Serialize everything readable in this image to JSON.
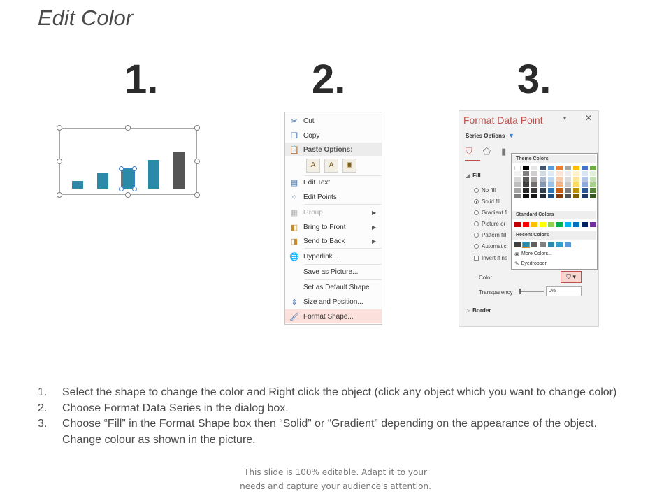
{
  "title": "Edit Color",
  "steps": [
    "1.",
    "2.",
    "3."
  ],
  "chart": {
    "values": [
      1,
      2,
      3,
      4,
      5
    ],
    "selected_index": 2
  },
  "context_menu": {
    "items": [
      {
        "label": "Cut",
        "icon": "scissors-icon",
        "state": "normal"
      },
      {
        "label": "Copy",
        "icon": "copy-icon",
        "state": "normal"
      },
      {
        "label": "Paste Options:",
        "icon": "paste-icon",
        "state": "header"
      },
      {
        "label": "Edit Text",
        "icon": "edit-text-icon",
        "state": "normal"
      },
      {
        "label": "Edit Points",
        "icon": "edit-points-icon",
        "state": "normal"
      },
      {
        "label": "Group",
        "icon": "group-icon",
        "state": "disabled",
        "submenu": true
      },
      {
        "label": "Bring to Front",
        "icon": "bring-to-front-icon",
        "state": "normal",
        "submenu": true
      },
      {
        "label": "Send to Back",
        "icon": "send-to-back-icon",
        "state": "normal",
        "submenu": true
      },
      {
        "label": "Hyperlink...",
        "icon": "hyperlink-icon",
        "state": "normal"
      },
      {
        "label": "Save as Picture...",
        "icon": "",
        "state": "normal"
      },
      {
        "label": "Set as Default Shape",
        "icon": "",
        "state": "normal"
      },
      {
        "label": "Size and Position...",
        "icon": "size-position-icon",
        "state": "normal"
      },
      {
        "label": "Format Shape...",
        "icon": "format-shape-icon",
        "state": "highlight"
      }
    ]
  },
  "format_panel": {
    "title": "Format Data Point",
    "series_options": "Series Options",
    "fill_label": "Fill",
    "fill_options": [
      {
        "label": "No fill",
        "type": "radio",
        "checked": false
      },
      {
        "label": "Solid fill",
        "type": "radio",
        "checked": true
      },
      {
        "label": "Gradient fi",
        "type": "radio",
        "checked": false
      },
      {
        "label": "Picture or",
        "type": "radio",
        "checked": false
      },
      {
        "label": "Pattern fill",
        "type": "radio",
        "checked": false
      },
      {
        "label": "Automatic",
        "type": "radio",
        "checked": false
      },
      {
        "label": "Invert if ne",
        "type": "check",
        "checked": false
      }
    ],
    "color_label": "Color",
    "transparency_label": "Transparency",
    "transparency_value": "0%",
    "border_label": "Border",
    "accent_color": "#c0504d"
  },
  "color_popup": {
    "theme_header": "Theme Colors",
    "theme_colors": [
      [
        "#ffffff",
        "#000000",
        "#e7e6e6",
        "#44546a",
        "#5b9bd5",
        "#ed7d31",
        "#a5a5a5",
        "#ffc000",
        "#4472c4",
        "#70ad47"
      ],
      [
        "#f2f2f2",
        "#7f7f7f",
        "#d0cece",
        "#d6dce4",
        "#deebf6",
        "#fbe5d5",
        "#ededed",
        "#fff2cc",
        "#dae3f3",
        "#e2efd9"
      ],
      [
        "#d8d8d8",
        "#595959",
        "#aeabab",
        "#adb9ca",
        "#bdd7ee",
        "#f8cbad",
        "#dbdbdb",
        "#fee599",
        "#b4c6e7",
        "#c5e0b3"
      ],
      [
        "#bfbfbf",
        "#3f3f3f",
        "#757070",
        "#8496b0",
        "#9cc3e5",
        "#f4b183",
        "#c9c9c9",
        "#ffd965",
        "#8eaadb",
        "#a8d08d"
      ],
      [
        "#a5a5a5",
        "#262626",
        "#3a3838",
        "#323f4f",
        "#2e75b5",
        "#c55a11",
        "#7b7b7b",
        "#bf9000",
        "#2f5496",
        "#538135"
      ],
      [
        "#7f7f7f",
        "#0c0c0c",
        "#171616",
        "#222a35",
        "#1e4e79",
        "#833c0b",
        "#525252",
        "#7f6000",
        "#1f3864",
        "#375623"
      ]
    ],
    "standard_header": "Standard Colors",
    "standard_colors": [
      "#c00000",
      "#ff0000",
      "#ffc000",
      "#ffff00",
      "#92d050",
      "#00b050",
      "#00b0f0",
      "#0070c0",
      "#002060",
      "#7030a0"
    ],
    "recent_header": "Recent Colors",
    "recent_colors": [
      "#404040",
      "#2a8aa8",
      "#606060",
      "#7f7f7f",
      "#2a8aa8",
      "#31a0c8",
      "#5b9bd5"
    ],
    "more_colors": "More Colors...",
    "eyedropper": "Eyedropper"
  },
  "instructions": [
    {
      "num": "1.",
      "text": "Select the shape to change the color and Right click the object (click any object which you want to change color)"
    },
    {
      "num": "2.",
      "text": "Choose Format Data Series in the dialog box."
    },
    {
      "num": "3.",
      "text": "Choose “Fill” in the Format Shape box then “Solid” or “Gradient” depending on the appearance of the object. Change colour as shown in the picture."
    }
  ],
  "footer": {
    "line1": "This slide is 100% editable. Adapt it to your",
    "line2": "needs and capture your audience's attention."
  },
  "colors": {
    "bar": "#2a8aa8",
    "bar_dark": "#555555",
    "selection": "#3d7fd1"
  }
}
